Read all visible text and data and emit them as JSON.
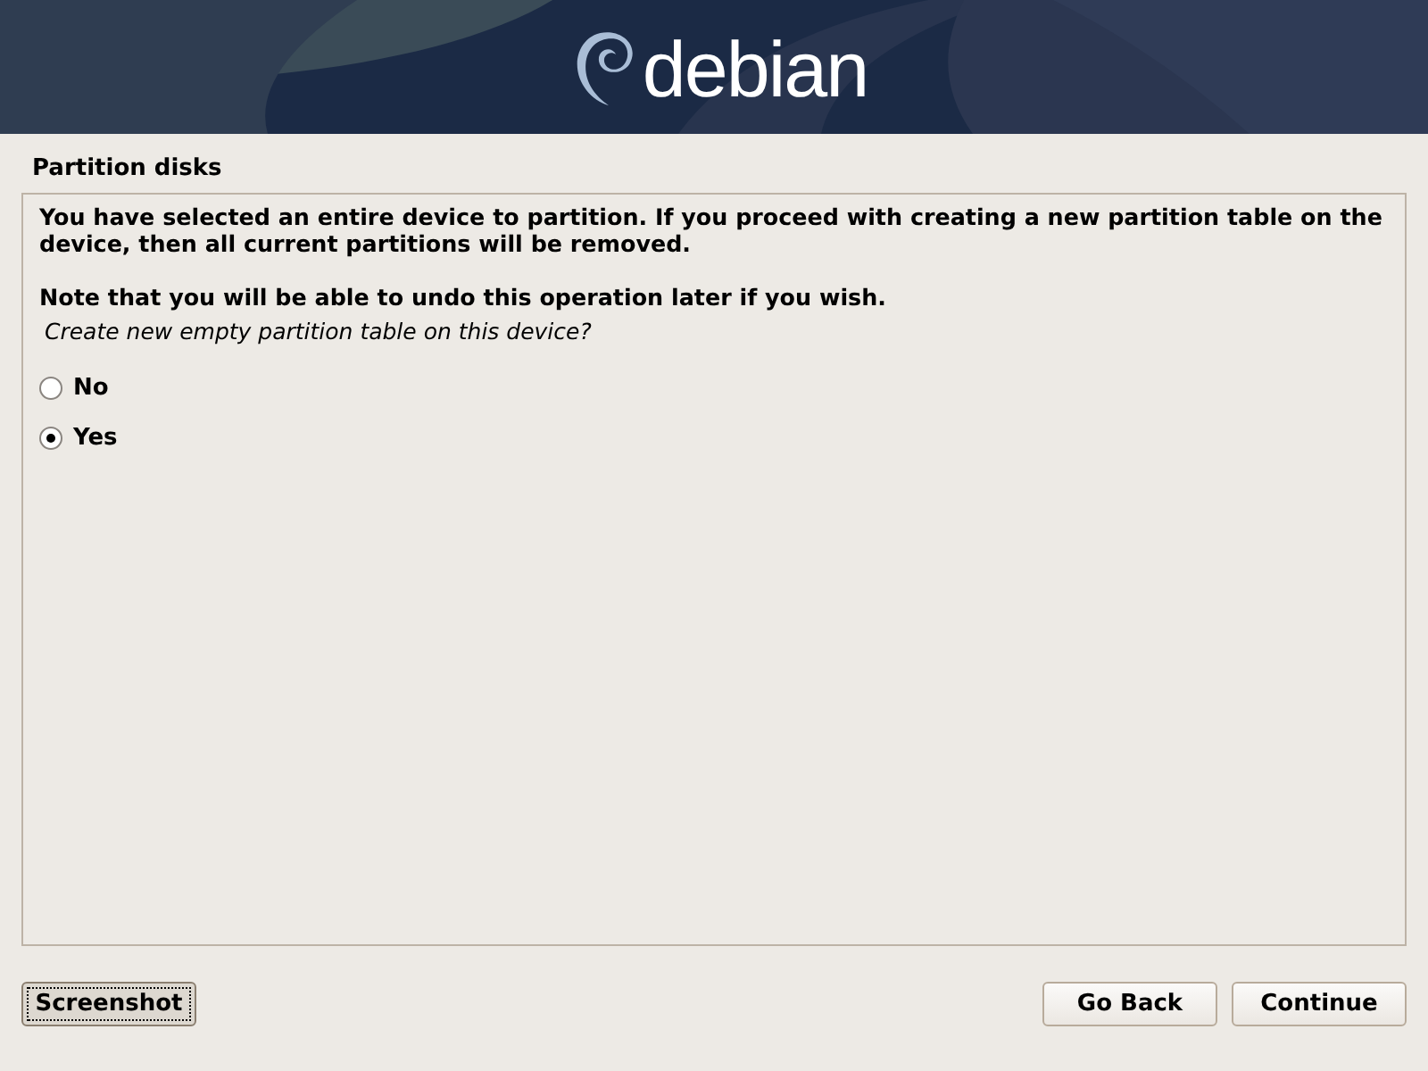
{
  "header": {
    "logo": "debian"
  },
  "title": "Partition disks",
  "paragraphs": [
    "You have selected an entire device to partition. If you proceed with creating a new partition table on the device, then all current partitions will be removed.",
    "Note that you will be able to undo this operation later if you wish."
  ],
  "question": "Create new empty partition table on this device?",
  "options": [
    {
      "label": "No",
      "selected": false
    },
    {
      "label": "Yes",
      "selected": true
    }
  ],
  "left_buttons": [
    {
      "label": "Screenshot",
      "focused": true
    }
  ],
  "right_buttons": [
    {
      "label": "Go Back",
      "focused": false
    },
    {
      "label": "Continue",
      "focused": false
    }
  ]
}
